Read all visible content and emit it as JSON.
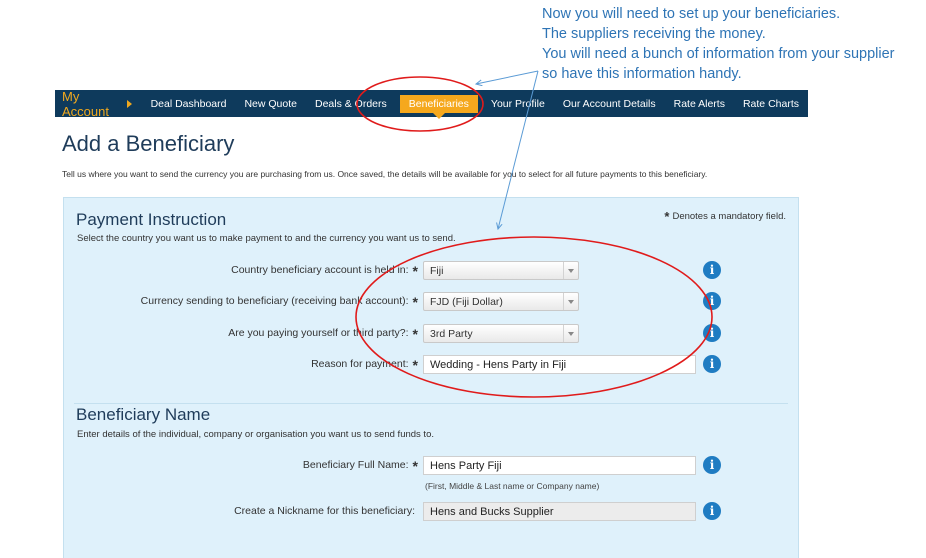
{
  "annotation": {
    "lines": [
      "Now you will  need to set up your beneficiaries.",
      "The suppliers receiving the money.",
      "You will need a bunch of information from your supplier",
      "so have this information handy."
    ],
    "color": "#2e74b5"
  },
  "nav": {
    "my_account": "My Account",
    "items": [
      "Deal Dashboard",
      "New Quote",
      "Deals & Orders",
      "Beneficiaries",
      "Your Profile",
      "Our Account Details",
      "Rate Alerts",
      "Rate Charts"
    ],
    "active": "Beneficiaries",
    "bg_color": "#0e3a5c",
    "accent_color": "#f5a81d"
  },
  "page": {
    "title": "Add a Beneficiary",
    "intro": "Tell us where you want to send the currency you are purchasing from us. Once saved, the details will be available for you to select for all future payments to this beneficiary."
  },
  "payment": {
    "title": "Payment Instruction",
    "subtitle": "Select the country you want us to make payment to and the currency you want us to send.",
    "mandatory_star": "*",
    "mandatory_note": "Denotes a mandatory field.",
    "country_label": "Country beneficiary account is held in:",
    "country_value": "Fiji",
    "currency_label": "Currency sending to beneficiary (receiving bank account):",
    "currency_value": "FJD (Fiji Dollar)",
    "party_label": "Are you paying yourself or third party?:",
    "party_value": "3rd Party",
    "reason_label": "Reason for payment:",
    "reason_value": "Wedding - Hens Party in Fiji"
  },
  "beneficiary": {
    "title": "Beneficiary Name",
    "subtitle": "Enter details of the individual, company or organisation you want us to send funds to.",
    "fullname_label": "Beneficiary Full Name:",
    "fullname_value": "Hens Party Fiji",
    "fullname_hint": "(First, Middle & Last name or Company name)",
    "nickname_label": "Create a Nickname for this beneficiary:",
    "nickname_value": "Hens and Bucks Supplier"
  },
  "star": "*",
  "info_glyph": "i",
  "highlight_color": "#e01b1b"
}
